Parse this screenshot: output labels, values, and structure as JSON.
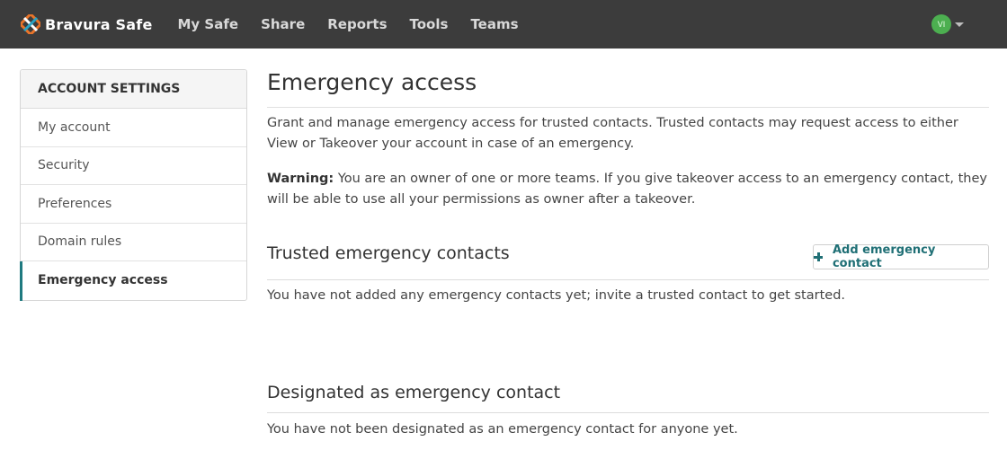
{
  "topbar": {
    "brand": "Bravura Safe",
    "nav": [
      "My Safe",
      "Share",
      "Reports",
      "Tools",
      "Teams"
    ],
    "avatar_initials": "VI",
    "bg_color": "#3c3c3c",
    "avatar_color": "#4caf50"
  },
  "sidebar": {
    "header": "ACCOUNT SETTINGS",
    "items": [
      {
        "label": "My account",
        "active": false
      },
      {
        "label": "Security",
        "active": false
      },
      {
        "label": "Preferences",
        "active": false
      },
      {
        "label": "Domain rules",
        "active": false
      },
      {
        "label": "Emergency access",
        "active": true
      }
    ],
    "accent_color": "#1f7a80"
  },
  "main": {
    "title": "Emergency access",
    "intro": "Grant and manage emergency access for trusted contacts. Trusted contacts may request access to either View or Takeover your account in case of an emergency.",
    "warning_label": "Warning:",
    "warning_text": " You are an owner of one or more teams. If you give takeover access to an emergency contact, they will be able to use all your permissions as owner after a takeover.",
    "trusted": {
      "title": "Trusted emergency contacts",
      "add_button": "Add emergency contact",
      "empty_text": "You have not added any emergency contacts yet; invite a trusted contact to get started."
    },
    "designated": {
      "title": "Designated as emergency contact",
      "empty_text": "You have not been designated as an emergency contact for anyone yet."
    }
  }
}
